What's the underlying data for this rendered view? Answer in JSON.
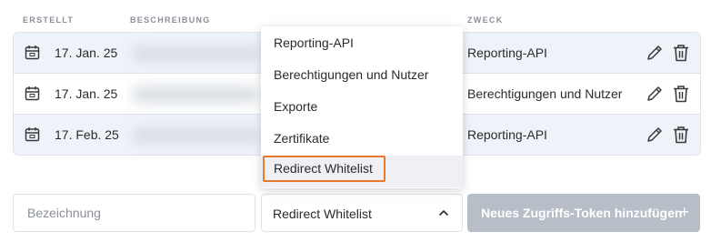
{
  "columns": {
    "created": "ERSTELLT",
    "description": "BESCHREIBUNG",
    "purpose": "ZWECK"
  },
  "rows": [
    {
      "date": "17. Jan. 25",
      "purpose": "Reporting-API"
    },
    {
      "date": "17. Jan. 25",
      "purpose": "Berechtigungen und Nutzer"
    },
    {
      "date": "17. Feb. 25",
      "purpose": "Reporting-API"
    }
  ],
  "dropdown": {
    "options": [
      "Reporting-API",
      "Berechtigungen und Nutzer",
      "Exporte",
      "Zertifikate",
      "Redirect Whitelist"
    ],
    "highlighted": "Redirect Whitelist"
  },
  "form": {
    "name_placeholder": "Bezeichnung",
    "purpose_selected": "Redirect Whitelist",
    "add_button_label": "Neues Zugriffs-Token hinzufügen",
    "add_button_icon": "+"
  },
  "colors": {
    "row_tint": "#eef3f9",
    "focus_ring": "#e8792e",
    "button_disabled": "#b8bec7"
  }
}
